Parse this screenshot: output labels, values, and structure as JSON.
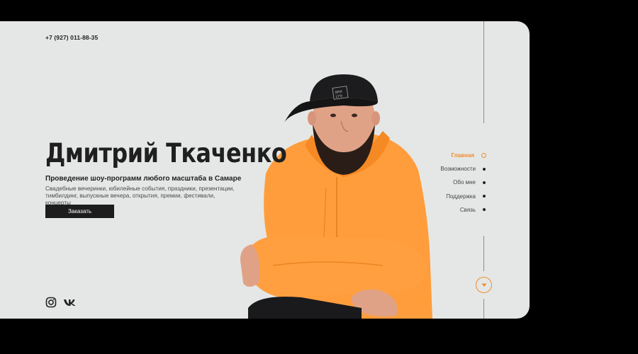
{
  "header": {
    "phone": "+7 (927) 011-88-35"
  },
  "hero": {
    "name": "Дмитрий Ткаченко",
    "tagline": "Проведение шоу-программ любого масштаба в Самаре",
    "description_line1": "Свадебные вечеринки, юбилейные события, праздники, презентации,",
    "description_line2": "тимбилдинг, выпускные вечера, открытия, премии, фестивали, концерты",
    "order_button": "Заказать"
  },
  "nav": {
    "items": [
      {
        "label": "Главная",
        "active": true
      },
      {
        "label": "Возможности",
        "active": false
      },
      {
        "label": "Обо мне",
        "active": false
      },
      {
        "label": "Поддержка",
        "active": false
      },
      {
        "label": "Связь",
        "active": false
      }
    ]
  },
  "photo": {
    "cap_text_1": "BRK",
    "cap_text_2": "LYN"
  },
  "social": {
    "icons": [
      "instagram-icon",
      "vk-icon"
    ]
  },
  "colors": {
    "accent": "#f28c28",
    "background": "#e5e7e6",
    "button": "#1d1d1d",
    "hoodie": "#ff9d3c"
  }
}
